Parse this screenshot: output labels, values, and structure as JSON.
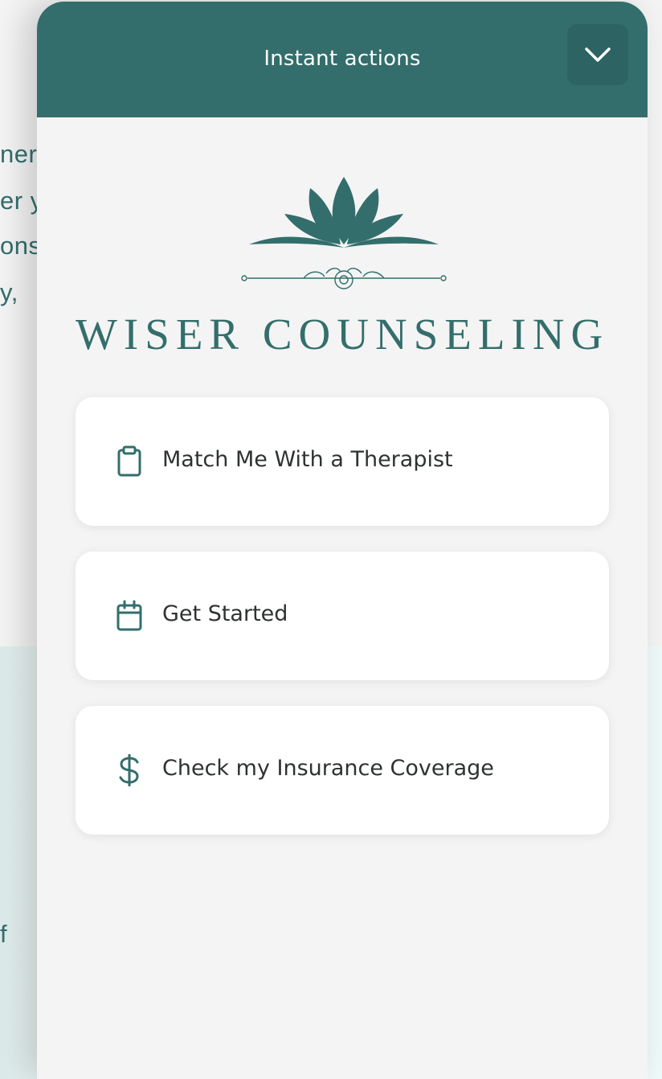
{
  "background": {
    "text_fragments": [
      "nere",
      "er y",
      "ons",
      "y,",
      "f"
    ]
  },
  "panel": {
    "title": "Instant actions",
    "collapse_icon": "chevron-down-icon"
  },
  "logo": {
    "text": "WISER COUNSELING",
    "icon": "lotus-icon"
  },
  "actions": [
    {
      "label": "Match Me With a Therapist",
      "icon": "clipboard-icon"
    },
    {
      "label": "Get Started",
      "icon": "calendar-icon"
    },
    {
      "label": "Check my Insurance Coverage",
      "icon": "dollar-icon"
    }
  ],
  "colors": {
    "brand_teal": "#336e6c",
    "panel_bg": "#f4f4f4",
    "card_bg": "#ffffff",
    "text": "#2f3232"
  }
}
